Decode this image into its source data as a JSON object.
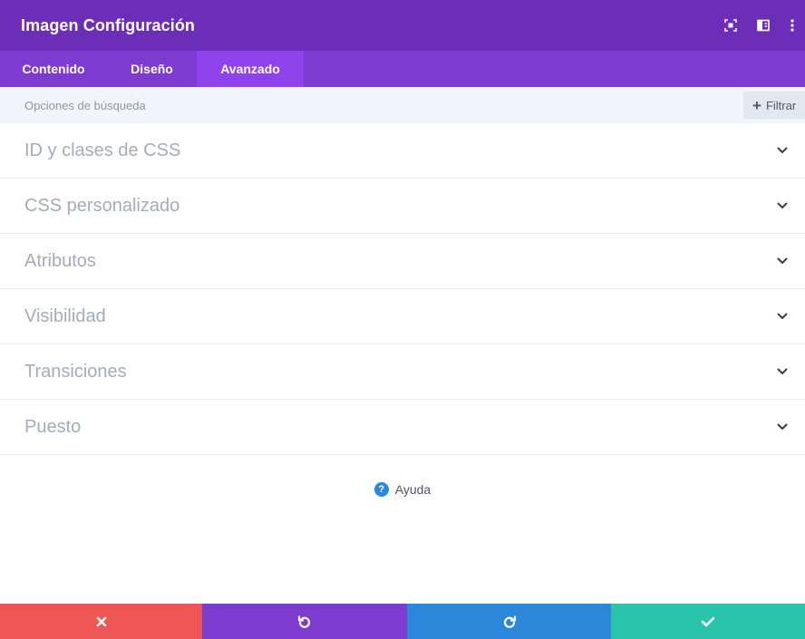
{
  "header": {
    "title": "Imagen Configuración",
    "actions": [
      {
        "icon": "fullscreen-icon"
      },
      {
        "icon": "sidebar-layout-icon"
      },
      {
        "icon": "more-vertical-icon"
      }
    ]
  },
  "tabs": [
    {
      "label": "Contenido",
      "active": false
    },
    {
      "label": "Diseño",
      "active": false
    },
    {
      "label": "Avanzado",
      "active": true
    }
  ],
  "search": {
    "placeholder": "Opciones de búsqueda",
    "value": "",
    "filter_label": "Filtrar"
  },
  "sections": [
    {
      "label": "ID y clases de CSS"
    },
    {
      "label": "CSS personalizado"
    },
    {
      "label": "Atributos"
    },
    {
      "label": "Visibilidad"
    },
    {
      "label": "Transiciones"
    },
    {
      "label": "Puesto"
    }
  ],
  "help": {
    "label": "Ayuda",
    "icon_glyph": "?"
  },
  "footer": {
    "buttons": [
      {
        "icon": "close-icon",
        "color": "#ef5555"
      },
      {
        "icon": "undo-icon",
        "color": "#7e3bd0"
      },
      {
        "icon": "redo-icon",
        "color": "#2b87da"
      },
      {
        "icon": "check-icon",
        "color": "#29c4a9"
      }
    ]
  },
  "colors": {
    "header_bg": "#6c2eb9",
    "tabs_bg": "#7e3bd0",
    "active_tab_bg": "#8f42ec",
    "search_bg": "#f1f5f9",
    "section_text": "#a2adb9",
    "help_blue": "#2b87da"
  }
}
